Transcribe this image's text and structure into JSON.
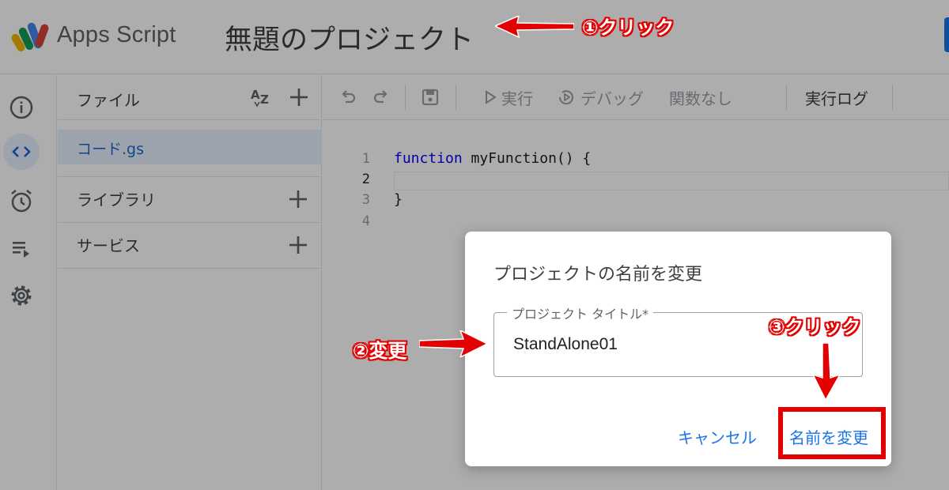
{
  "header": {
    "app_name": "Apps Script",
    "project_title": "無題のプロジェクト"
  },
  "files_panel": {
    "files_label": "ファイル",
    "file_name": "コード.gs",
    "libraries_label": "ライブラリ",
    "services_label": "サービス"
  },
  "toolbar": {
    "run_label": "実行",
    "debug_label": "デバッグ",
    "function_select": "関数なし",
    "exec_log_label": "実行ログ"
  },
  "editor": {
    "line_numbers": [
      "1",
      "2",
      "3",
      "4"
    ],
    "code_lines": {
      "line1_keyword": "function",
      "line1_rest": " myFunction() {",
      "line3": "}"
    }
  },
  "dialog": {
    "title": "プロジェクトの名前を変更",
    "field_label": "プロジェクト タイトル*",
    "field_value": "StandAlone01",
    "cancel_label": "キャンセル",
    "rename_label": "名前を変更"
  },
  "annotations": {
    "step1": "①クリック",
    "step2": "②変更",
    "step3": "③クリック"
  },
  "colors": {
    "accent": "#1a73e8",
    "annotation_red": "#e30000"
  }
}
